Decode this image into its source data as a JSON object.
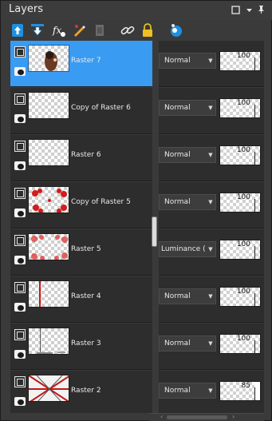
{
  "panel": {
    "title": "Layers",
    "buttons": [
      "maximize-icon",
      "dropdown-icon",
      "pin-icon"
    ]
  },
  "toolbar": {
    "tools": [
      "new-raster-layer-icon",
      "new-layer-below-icon",
      "layer-visibility-icon",
      "edit-layer-icon",
      "delete-layer-icon",
      "link-layers-icon",
      "lock-layer-icon",
      "layer-properties-icon"
    ]
  },
  "layers": [
    {
      "name": "Raster 7",
      "blend": "Normal",
      "opacity": 100,
      "selected": true
    },
    {
      "name": "Copy of Raster 6",
      "blend": "Normal",
      "opacity": 100,
      "selected": false
    },
    {
      "name": "Raster 6",
      "blend": "Normal",
      "opacity": 100,
      "selected": false
    },
    {
      "name": "Copy of Raster 5",
      "blend": "Normal",
      "opacity": 100,
      "selected": false
    },
    {
      "name": "Raster 5",
      "blend": "Luminance (L)",
      "opacity": 100,
      "selected": false
    },
    {
      "name": "Raster 4",
      "blend": "Normal",
      "opacity": 100,
      "selected": false
    },
    {
      "name": "Raster 3",
      "blend": "Normal",
      "opacity": 100,
      "selected": false
    },
    {
      "name": "Raster 2",
      "blend": "Normal",
      "opacity": 85,
      "selected": false
    }
  ],
  "colors": {
    "selected": "#3a9bf2",
    "row_bg": "#2d2d2d",
    "panel_bg": "#3a3a3a"
  }
}
